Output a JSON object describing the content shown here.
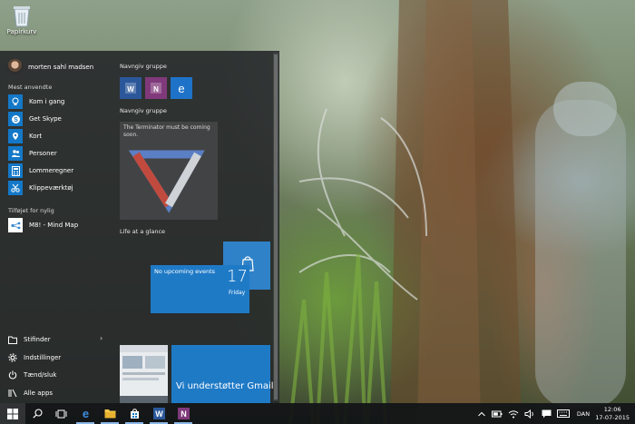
{
  "desktop": {
    "recycle_bin_label": "Papirkurv"
  },
  "start_menu": {
    "user_name": "morten sahl madsen",
    "most_used_label": "Mest anvendte",
    "most_used": [
      {
        "label": "Kom i gang",
        "icon": "lightbulb-icon"
      },
      {
        "label": "Get Skype",
        "icon": "skype-icon"
      },
      {
        "label": "Kort",
        "icon": "maps-icon"
      },
      {
        "label": "Personer",
        "icon": "people-icon"
      },
      {
        "label": "Lommeregner",
        "icon": "calculator-icon"
      },
      {
        "label": "Klippeværktøj",
        "icon": "scissors-icon"
      }
    ],
    "recently_added_label": "Tilføjet for nylig",
    "recently_added": [
      {
        "label": "M8! - Mind Map",
        "icon": "mindmap-icon"
      }
    ],
    "bottom": {
      "explorer": "Stifinder",
      "settings": "Indstillinger",
      "power": "Tænd/sluk",
      "all_apps": "Alle apps"
    },
    "groups": [
      {
        "name": "Navngiv gruppe"
      },
      {
        "name": "Navngiv gruppe"
      },
      {
        "name": "Life at a glance"
      }
    ],
    "tiles": {
      "movie_caption": "The Terminator must be coming soon.",
      "calendar_event": "No upcoming events",
      "calendar_date": "17",
      "calendar_day": "Friday",
      "mail_text": "Vi understøtter Gmail"
    }
  },
  "taskbar": {
    "language": "DAN",
    "time": "12:06",
    "date": "17-07-2015"
  },
  "colors": {
    "accent": "#1478c8",
    "word": "#2b579a",
    "onenote": "#80397b",
    "edge": "#1e73c8"
  }
}
